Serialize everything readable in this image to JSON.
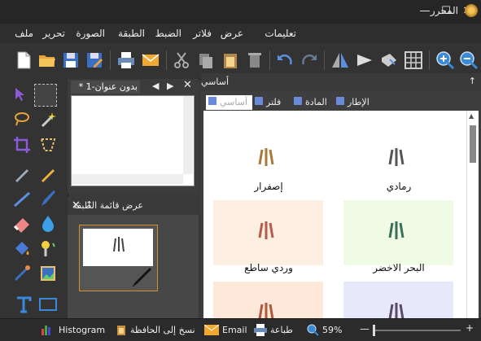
{
  "window": {
    "title": "المحرر"
  },
  "menu": [
    "ملف",
    "تحرير",
    "الصورة",
    "الطبقة",
    "الضبط",
    "فلاتر",
    "عرض",
    "تعليمات"
  ],
  "document": {
    "tab_title": "* بدون عنوان-1"
  },
  "layers": {
    "title": "عرض قائمة الطبقة"
  },
  "presets_panel": {
    "title": "أساسي",
    "tabs": [
      "الإطار",
      "المادة",
      "فلتر",
      "أساسي"
    ],
    "items": [
      {
        "label": "رمادي"
      },
      {
        "label": "إصفرار"
      },
      {
        "label": "البحر الاخضر"
      },
      {
        "label": "وردي ساطع"
      }
    ]
  },
  "status": {
    "zoom": "59%",
    "print": "طباعة",
    "email": "Email",
    "copy": "نسخ إلى الحافظة",
    "histogram": "Histogram"
  }
}
